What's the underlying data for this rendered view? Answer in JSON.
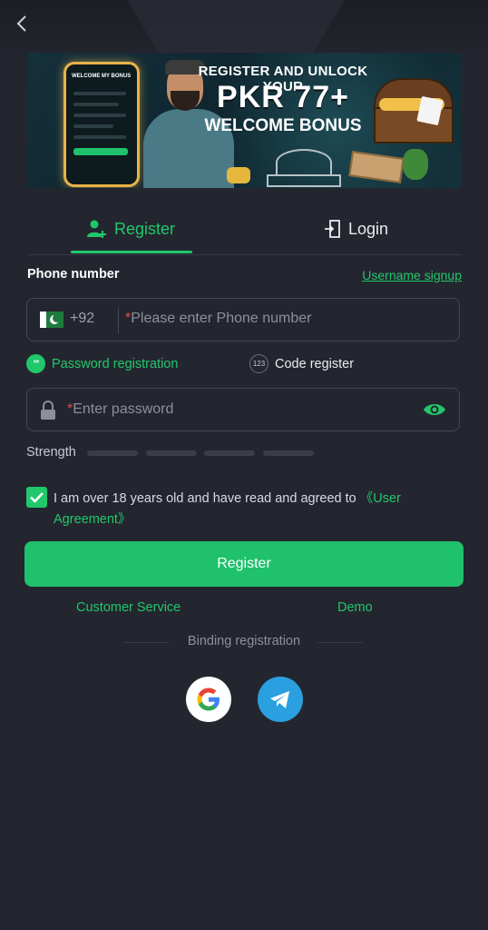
{
  "banner": {
    "line1": "REGISTER AND UNLOCK YOUR",
    "line2": "PKR 77+",
    "line3": "WELCOME BONUS",
    "phone_title": "WELCOME MY BONUS"
  },
  "tabs": {
    "register": "Register",
    "login": "Login"
  },
  "form": {
    "phone_label": "Phone number",
    "username_signup": "Username signup",
    "country_code": "+92",
    "phone_placeholder": "Please enter Phone number",
    "modes": {
      "password": "Password registration",
      "code": "Code register",
      "password_glyph": "**",
      "code_glyph": "123"
    },
    "password_placeholder": "Enter password",
    "strength_label": "Strength",
    "required_mark": "*",
    "agreement_text": "I am over 18 years old and have read and agreed to ",
    "agreement_link": "《User Agreement》",
    "agreement_checked": true,
    "register_button": "Register"
  },
  "links": {
    "customer_service": "Customer Service",
    "demo": "Demo"
  },
  "binding": {
    "label": "Binding registration"
  },
  "colors": {
    "accent": "#20c86b",
    "background": "#24262f",
    "input_border": "#434655",
    "required": "#e5484d"
  },
  "icons": {
    "back": "chevron-left-icon",
    "register_tab": "user-add-icon",
    "login_tab": "door-enter-icon",
    "lock": "lock-icon",
    "eye": "eye-icon",
    "google": "google-icon",
    "telegram": "telegram-icon"
  }
}
